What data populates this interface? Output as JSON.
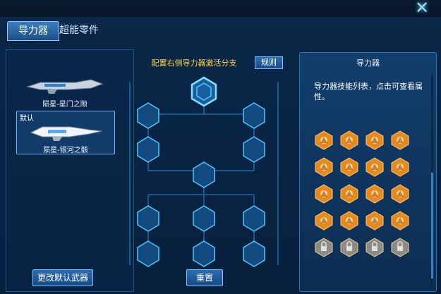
{
  "window": {
    "close_glyph": "✕"
  },
  "tabs": [
    {
      "label": "导力器",
      "active": true
    },
    {
      "label": "超能零件",
      "active": false
    }
  ],
  "weapons": [
    {
      "name": "陨星-星门之隙",
      "default": false,
      "selected": false
    },
    {
      "name": "陨星-银河之骸",
      "default": true,
      "default_label": "默认",
      "selected": true
    }
  ],
  "buttons": {
    "change_default": "更改默认武器",
    "rules": "规则",
    "reset": "重置"
  },
  "center": {
    "title": "配置右侧导力器激活分支"
  },
  "right_panel": {
    "title": "导力器",
    "description": "导力器技能列表，点击可查看属性。"
  },
  "skills": {
    "active_color": "#e8891c",
    "locked_color": "#8a8a86",
    "rows": [
      [
        "active",
        "active",
        "active",
        "active"
      ],
      [
        "active",
        "active",
        "active",
        "active"
      ],
      [
        "active",
        "active",
        "active",
        "active"
      ],
      [
        "active",
        "active",
        "active",
        "active"
      ],
      [
        "locked",
        "locked",
        "locked",
        "locked"
      ]
    ]
  },
  "colors": {
    "accent": "#2a6aa8",
    "title_yellow": "#ffd24a",
    "hex_fill": "#134a80",
    "hex_stroke": "#4fc8ff"
  }
}
